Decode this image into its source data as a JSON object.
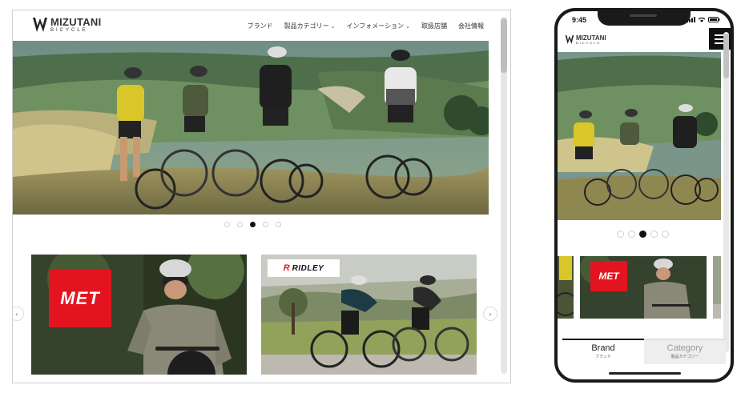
{
  "desktop": {
    "logo": {
      "name": "MIZUTANI",
      "sub": "BICYCLE"
    },
    "nav": [
      {
        "label": "ブランド",
        "has_dropdown": false
      },
      {
        "label": "製品カテゴリー",
        "has_dropdown": true
      },
      {
        "label": "インフォメーション",
        "has_dropdown": true
      },
      {
        "label": "取扱店舗",
        "has_dropdown": false
      },
      {
        "label": "会社情報",
        "has_dropdown": false
      }
    ],
    "slider": {
      "count": 5,
      "active": 3
    },
    "cards": [
      {
        "brand": "MET"
      },
      {
        "brand": "RIDLEY"
      }
    ],
    "prev_label": "‹",
    "next_label": "›"
  },
  "phone": {
    "time": "9:45",
    "logo": {
      "name": "MIZUTANI",
      "sub": "BICYCLE"
    },
    "slider": {
      "count": 5,
      "active": 2
    },
    "card_brand": "MET",
    "tabs": [
      {
        "label": "Brand",
        "sub": "ブランド",
        "active": true
      },
      {
        "label": "Category",
        "sub": "製品カテゴリー",
        "active": false
      }
    ]
  },
  "colors": {
    "accent": "#e3141f",
    "dark": "#111111",
    "jersey_yellow": "#d9c72a"
  }
}
